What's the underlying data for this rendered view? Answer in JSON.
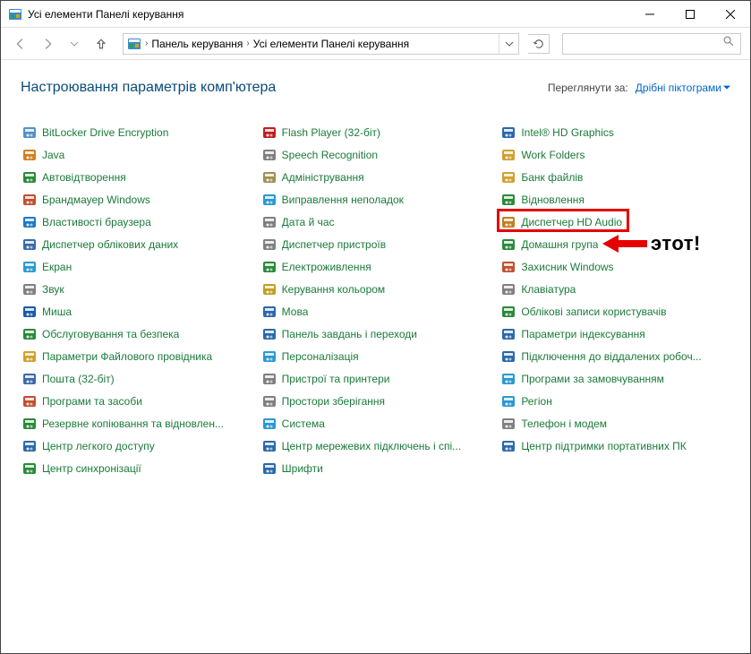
{
  "window": {
    "title": "Усі елементи Панелі керування"
  },
  "breadcrumb": {
    "part1": "Панель керування",
    "part2": "Усі елементи Панелі керування"
  },
  "search": {
    "placeholder": ""
  },
  "heading": "Настроювання параметрів комп'ютера",
  "viewby": {
    "label": "Переглянути за:",
    "value": "Дрібні піктограми"
  },
  "annotation": {
    "text": "этот!"
  },
  "columns": [
    {
      "items": [
        {
          "name": "bitlocker",
          "label": "BitLocker Drive Encryption",
          "iconColor": "#5590c8"
        },
        {
          "name": "java",
          "label": "Java",
          "iconColor": "#d08020"
        },
        {
          "name": "autoplay",
          "label": "Автовідтворення",
          "iconColor": "#2a8a3a"
        },
        {
          "name": "firewall",
          "label": "Брандмауер Windows",
          "iconColor": "#c05030"
        },
        {
          "name": "browser-props",
          "label": "Властивості браузера",
          "iconColor": "#1a7aca"
        },
        {
          "name": "credential-mgr",
          "label": "Диспетчер облікових даних",
          "iconColor": "#3a6aaa"
        },
        {
          "name": "display",
          "label": "Екран",
          "iconColor": "#2a9ad0"
        },
        {
          "name": "sound",
          "label": "Звук",
          "iconColor": "#808080"
        },
        {
          "name": "mouse",
          "label": "Миша",
          "iconColor": "#1a5aa8"
        },
        {
          "name": "maintenance",
          "label": "Обслуговування та безпека",
          "iconColor": "#2a8a3a"
        },
        {
          "name": "file-explorer-opts",
          "label": "Параметри Файлового провідника",
          "iconColor": "#d0a030"
        },
        {
          "name": "mail",
          "label": "Пошта (32-біт)",
          "iconColor": "#3a6aaa"
        },
        {
          "name": "programs-features",
          "label": "Програми та засоби",
          "iconColor": "#c05030"
        },
        {
          "name": "backup-restore",
          "label": "Резервне копіювання та відновлен...",
          "iconColor": "#2a8a3a"
        },
        {
          "name": "ease-of-access",
          "label": "Центр легкого доступу",
          "iconColor": "#2a6aaa"
        },
        {
          "name": "sync-center",
          "label": "Центр синхронізації",
          "iconColor": "#2a8a3a"
        }
      ]
    },
    {
      "items": [
        {
          "name": "flash",
          "label": "Flash Player (32-біт)",
          "iconColor": "#c02020"
        },
        {
          "name": "speech",
          "label": "Speech Recognition",
          "iconColor": "#808080"
        },
        {
          "name": "admin-tools",
          "label": "Адміністрування",
          "iconColor": "#a09050"
        },
        {
          "name": "troubleshoot",
          "label": "Виправлення неполадок",
          "iconColor": "#2a9ad0"
        },
        {
          "name": "date-time",
          "label": "Дата й час",
          "iconColor": "#808080"
        },
        {
          "name": "device-mgr",
          "label": "Диспетчер пристроїв",
          "iconColor": "#808080"
        },
        {
          "name": "power",
          "label": "Електроживлення",
          "iconColor": "#2a8a3a"
        },
        {
          "name": "color-mgmt",
          "label": "Керування кольором",
          "iconColor": "#c0a020"
        },
        {
          "name": "language",
          "label": "Мова",
          "iconColor": "#2a6aaa"
        },
        {
          "name": "taskbar-nav",
          "label": "Панель завдань і переходи",
          "iconColor": "#2a6aaa"
        },
        {
          "name": "personalize",
          "label": "Персоналізація",
          "iconColor": "#2a9ad0"
        },
        {
          "name": "devices-printers",
          "label": "Пристрої та принтери",
          "iconColor": "#808080"
        },
        {
          "name": "storage-spaces",
          "label": "Простори зберігання",
          "iconColor": "#808080"
        },
        {
          "name": "system",
          "label": "Система",
          "iconColor": "#2a9ad0"
        },
        {
          "name": "network-sharing",
          "label": "Центр мережевих підключень і спі...",
          "iconColor": "#2a6aaa"
        },
        {
          "name": "fonts",
          "label": "Шрифти",
          "iconColor": "#2a6aaa"
        }
      ]
    },
    {
      "items": [
        {
          "name": "intel-hd",
          "label": "Intel® HD Graphics",
          "iconColor": "#2a6aaa"
        },
        {
          "name": "work-folders",
          "label": "Work Folders",
          "iconColor": "#d0a030"
        },
        {
          "name": "file-bank",
          "label": "Банк файлів",
          "iconColor": "#d0a030"
        },
        {
          "name": "recovery",
          "label": "Відновлення",
          "iconColor": "#2a8a3a"
        },
        {
          "name": "hd-audio",
          "label": "Диспетчер HD Audio",
          "iconColor": "#c08020",
          "highlighted": true
        },
        {
          "name": "homegroup",
          "label": "Домашня група",
          "iconColor": "#2a8a3a"
        },
        {
          "name": "defender",
          "label": "Захисник Windows",
          "iconColor": "#c05030"
        },
        {
          "name": "keyboard",
          "label": "Клавіатура",
          "iconColor": "#808080"
        },
        {
          "name": "user-accounts",
          "label": "Облікові записи користувачів",
          "iconColor": "#2a8a3a"
        },
        {
          "name": "indexing",
          "label": "Параметри індексування",
          "iconColor": "#2a6aaa"
        },
        {
          "name": "remoteapp",
          "label": "Підключення до віддалених робоч...",
          "iconColor": "#2a6aaa"
        },
        {
          "name": "default-programs",
          "label": "Програми за замовчуванням",
          "iconColor": "#2a9ad0"
        },
        {
          "name": "region",
          "label": "Регіон",
          "iconColor": "#2a9ad0"
        },
        {
          "name": "phone-modem",
          "label": "Телефон і модем",
          "iconColor": "#808080"
        },
        {
          "name": "mobility-center",
          "label": "Центр підтримки портативних ПК",
          "iconColor": "#2a6aaa"
        }
      ]
    }
  ]
}
